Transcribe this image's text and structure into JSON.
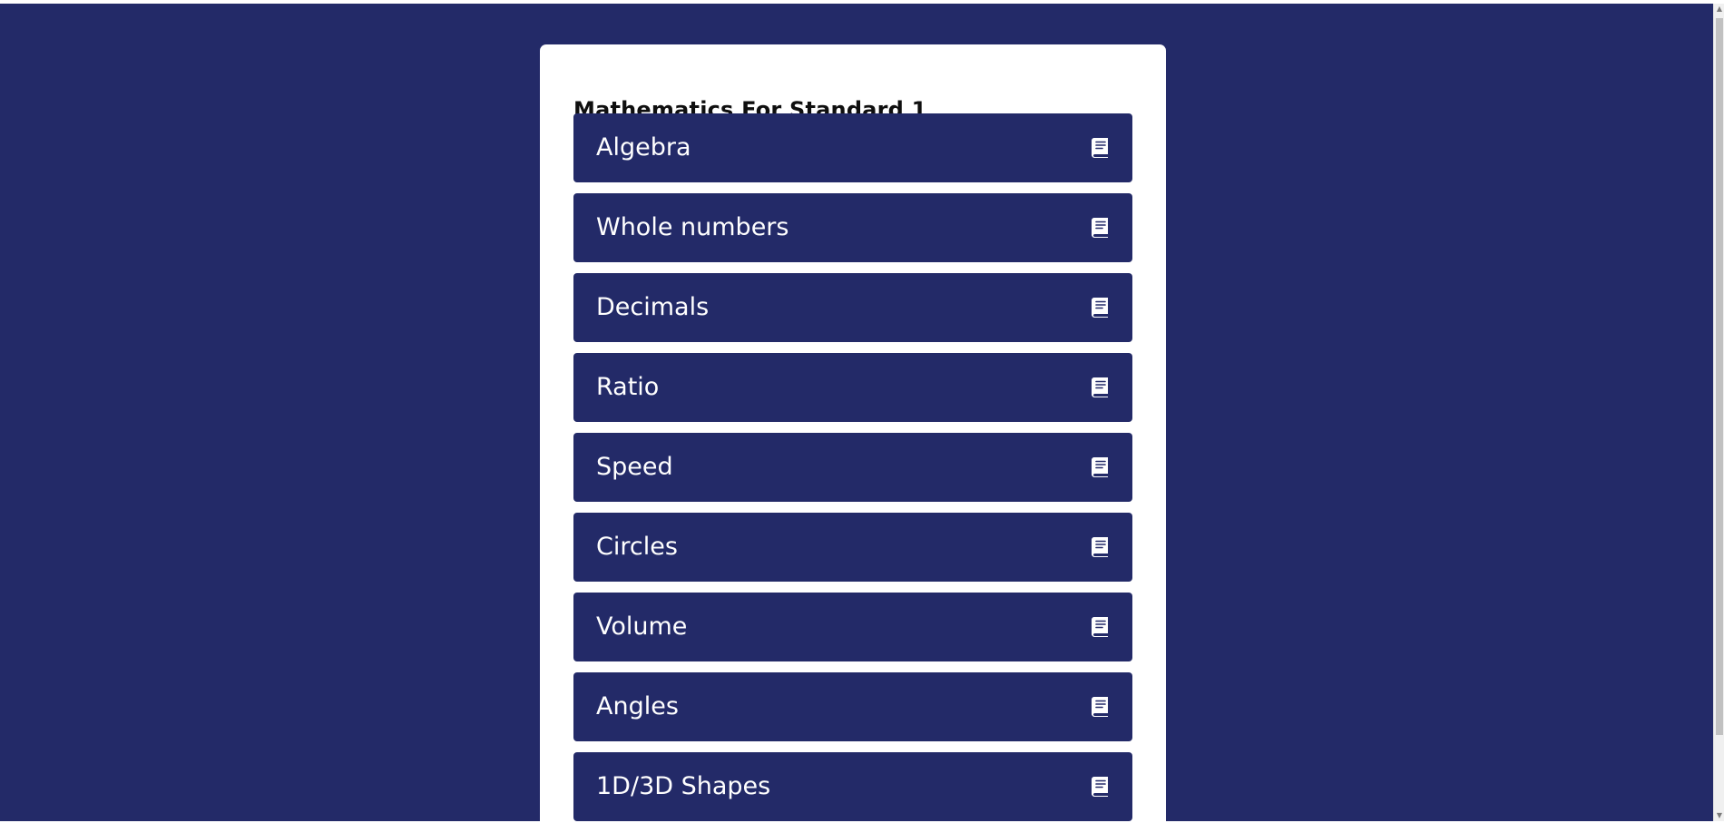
{
  "page": {
    "background_color": "#232a68",
    "card_color": "#ffffff",
    "accent_color": "#232a68",
    "text_color": "#ffffff"
  },
  "card": {
    "title": "Mathematics For Standard 1"
  },
  "subjects": [
    {
      "label": "Algebra",
      "icon": "book-icon"
    },
    {
      "label": "Whole numbers",
      "icon": "book-icon"
    },
    {
      "label": "Decimals",
      "icon": "book-icon"
    },
    {
      "label": "Ratio",
      "icon": "book-icon"
    },
    {
      "label": "Speed",
      "icon": "book-icon"
    },
    {
      "label": "Circles",
      "icon": "book-icon"
    },
    {
      "label": "Volume",
      "icon": "book-icon"
    },
    {
      "label": "Angles",
      "icon": "book-icon"
    },
    {
      "label": "1D/3D Shapes",
      "icon": "book-icon"
    }
  ],
  "scrollbar": {
    "up_arrow": "▲",
    "down_arrow": "▼"
  }
}
